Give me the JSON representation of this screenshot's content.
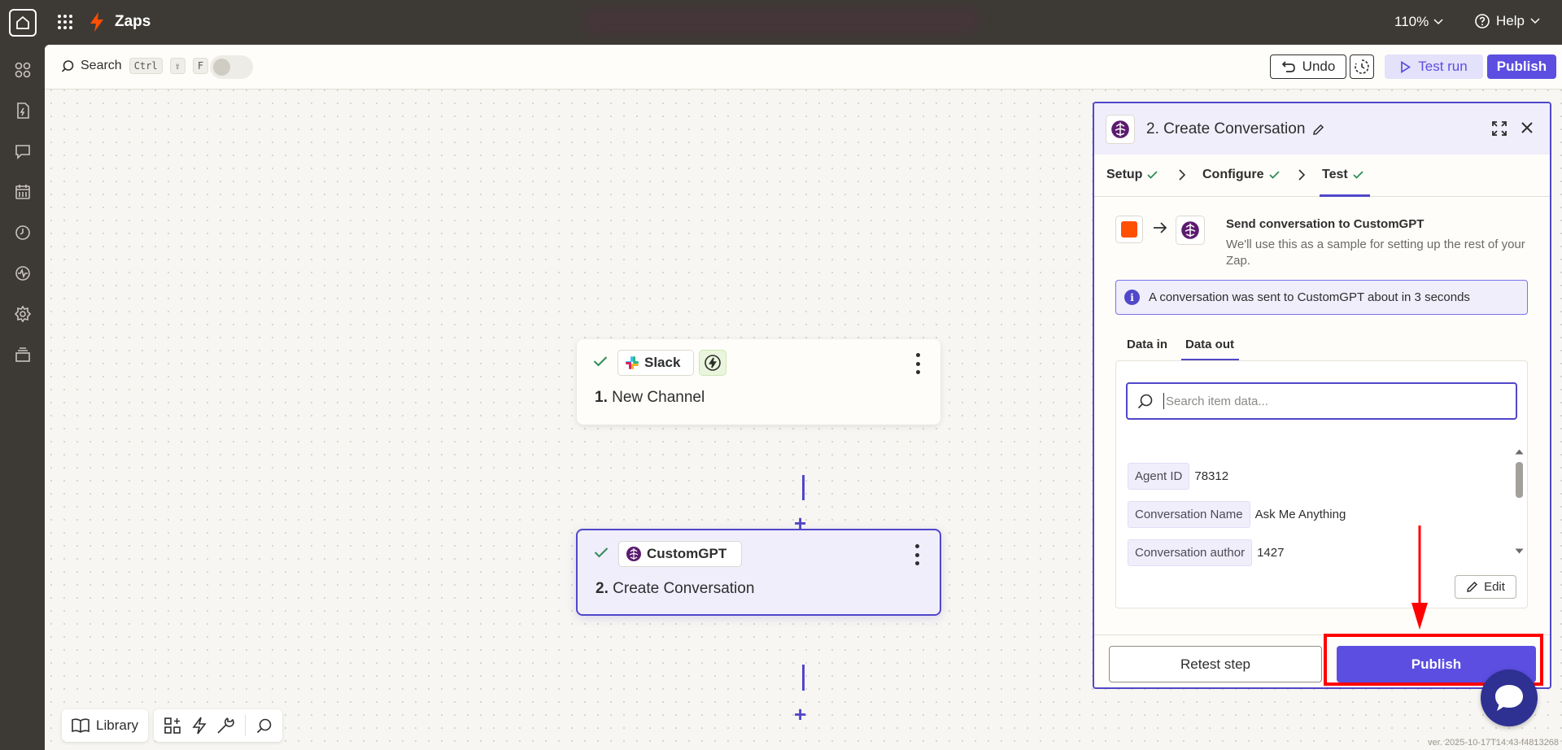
{
  "topbar": {
    "title": "Zaps",
    "zoom": "110%",
    "help": "Help"
  },
  "toolbar": {
    "search_label": "Search",
    "shortcut_ctrl": "Ctrl",
    "shortcut_shift": "⇧",
    "shortcut_key": "F",
    "undo_label": "Undo",
    "test_run_label": "Test run",
    "publish_label": "Publish"
  },
  "canvas": {
    "node1": {
      "app": "Slack",
      "number": "1.",
      "title": "New Channel"
    },
    "node2": {
      "app": "CustomGPT",
      "number": "2.",
      "title": "Create Conversation"
    }
  },
  "dock": {
    "library_label": "Library"
  },
  "panel": {
    "title": "2. Create Conversation",
    "steps": [
      {
        "label": "Setup",
        "done": true
      },
      {
        "label": "Configure",
        "done": true
      },
      {
        "label": "Test",
        "done": true,
        "active": true
      }
    ],
    "send_title": "Send conversation to CustomGPT",
    "send_desc": "We'll use this as a sample for setting up the rest of your Zap.",
    "info_text": "A conversation was sent to CustomGPT about in 3 seconds",
    "data_tabs": [
      "Data in",
      "Data out"
    ],
    "active_data_tab": "Data out",
    "search_placeholder": "Search item data...",
    "fields": [
      {
        "key": "Agent ID",
        "value": "78312"
      },
      {
        "key": "Conversation Name",
        "value": "Ask Me Anything"
      },
      {
        "key": "Conversation author",
        "value": "1427"
      }
    ],
    "edit_label": "Edit",
    "retest_label": "Retest step",
    "publish_label": "Publish"
  },
  "footer": {
    "version": "ver. 2025-10-17T14:43-f4813268"
  },
  "colors": {
    "brand_purple": "#5b4ee0",
    "zapier_orange": "#ff4f00",
    "success_green": "#2e8b57",
    "annotation_red": "#ff0000"
  }
}
